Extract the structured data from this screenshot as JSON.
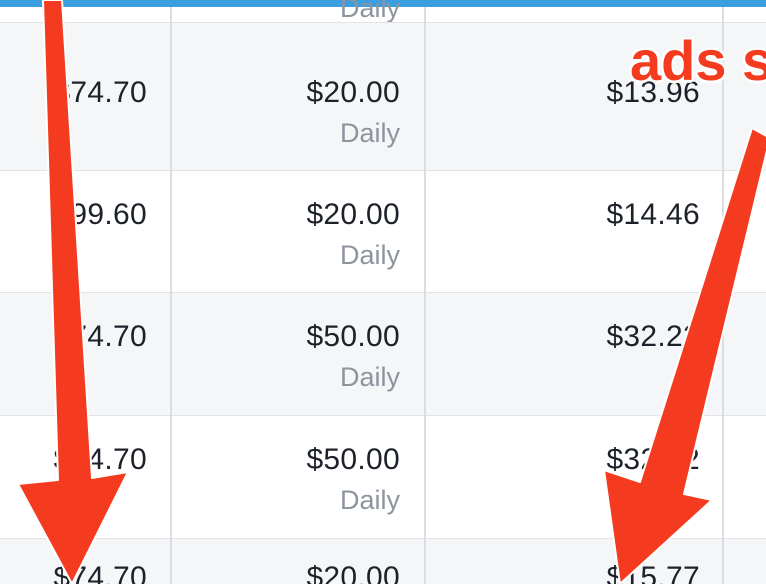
{
  "top_sub_label": "Daily",
  "rows": [
    {
      "amount_spent": "$74.70",
      "budget": "$20.00",
      "budget_type": "Daily",
      "cost": "$13.96"
    },
    {
      "amount_spent": "$99.60",
      "budget": "$20.00",
      "budget_type": "Daily",
      "cost": "$14.46"
    },
    {
      "amount_spent": "$74.70",
      "budget": "$50.00",
      "budget_type": "Daily",
      "cost": "$32.22"
    },
    {
      "amount_spent": "$74.70",
      "budget": "$50.00",
      "budget_type": "Daily",
      "cost": "$32.12"
    },
    {
      "amount_spent": "$74.70",
      "budget": "$20.00",
      "budget_type": "",
      "cost": "$15.77"
    }
  ],
  "annotation": {
    "text": "ads s",
    "color": "#f43a1f",
    "arrows": [
      "arrow-down-left",
      "arrow-down-right"
    ]
  },
  "colors": {
    "top_bar": "#3b9ee0",
    "row_alt": "#f5f6f8",
    "text": "#1d2129",
    "sub_text": "#8d949e"
  }
}
